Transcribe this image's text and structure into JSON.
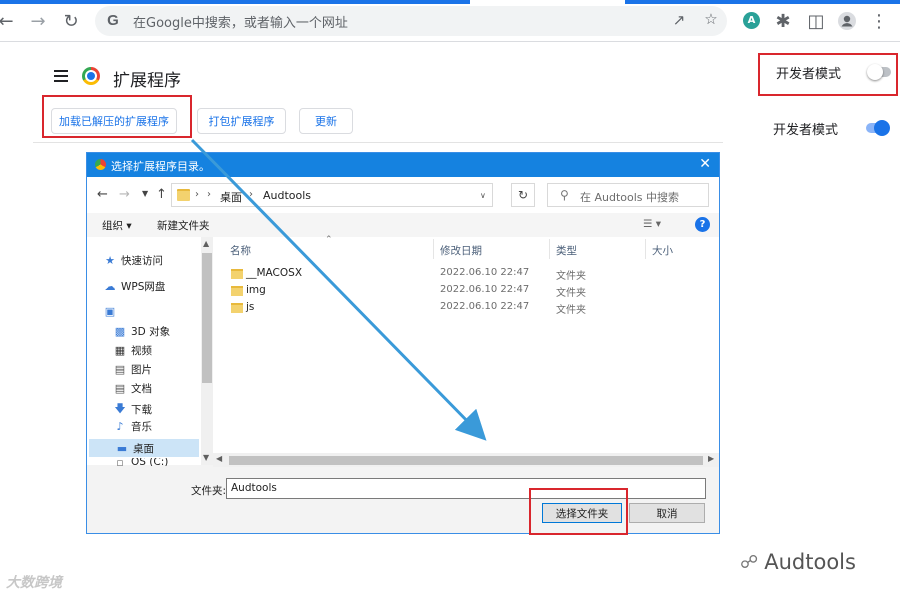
{
  "browser": {
    "omnibox_placeholder": "在Google中搜索，或者输入一个网址",
    "omnibox_icon": "G",
    "profile_badge": "A"
  },
  "extensions_page": {
    "title": "扩展程序",
    "buttons": {
      "load_unpacked": "加载已解压的扩展程序",
      "pack": "打包扩展程序",
      "update": "更新"
    },
    "dev_mode_label_top": "开发者模式",
    "dev_mode_label_bottom": "开发者模式",
    "dev_mode_top_on": false,
    "dev_mode_bottom_on": true
  },
  "dialog": {
    "title": "选择扩展程序目录。",
    "path": {
      "crumbs": [
        "桌面",
        "Audtools"
      ]
    },
    "search_placeholder": "在 Audtools 中搜索",
    "toolbar": {
      "organize": "组织 ▾",
      "new_folder": "新建文件夹"
    },
    "nav_items": [
      {
        "label": "快速访问",
        "icon": "star-icon"
      },
      {
        "label": "WPS网盘",
        "icon": "cloud-icon"
      },
      {
        "label": "",
        "icon": "computer-icon"
      },
      {
        "label": "3D 对象",
        "icon": "cube-icon"
      },
      {
        "label": "视频",
        "icon": "video-icon"
      },
      {
        "label": "图片",
        "icon": "picture-icon"
      },
      {
        "label": "文档",
        "icon": "document-icon"
      },
      {
        "label": "下载",
        "icon": "download-icon"
      },
      {
        "label": "音乐",
        "icon": "music-icon"
      },
      {
        "label": "桌面",
        "icon": "desktop-icon"
      },
      {
        "label": "OS (C:)",
        "icon": "drive-icon"
      }
    ],
    "columns": {
      "name": "名称",
      "modified": "修改日期",
      "type": "类型",
      "size": "大小"
    },
    "files": [
      {
        "name": "__MACOSX",
        "modified": "2022.06.10 22:47",
        "type": "文件夹"
      },
      {
        "name": "img",
        "modified": "2022.06.10 22:47",
        "type": "文件夹"
      },
      {
        "name": "js",
        "modified": "2022.06.10 22:47",
        "type": "文件夹"
      }
    ],
    "folder_label": "文件夹:",
    "folder_value": "Audtools",
    "select_button": "选择文件夹",
    "cancel_button": "取消"
  },
  "watermarks": {
    "right": "Audtools",
    "left": "大数跨境"
  },
  "colors": {
    "accent": "#1a73e8",
    "highlight_box": "#d9262d",
    "dialog_title_bar": "#1582e0",
    "arrow": "#3a9ad9"
  }
}
